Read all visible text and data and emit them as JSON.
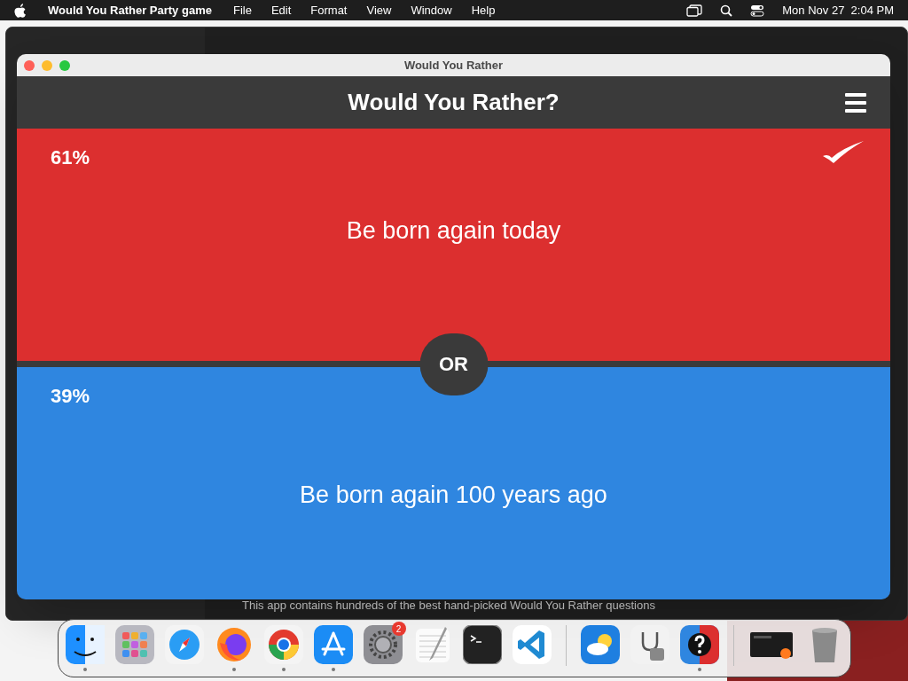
{
  "menu_bar": {
    "app_name": "Would You Rather Party game",
    "menus": [
      "File",
      "Edit",
      "Format",
      "View",
      "Window",
      "Help"
    ],
    "clock": "Mon Nov 27  2:04 PM"
  },
  "background_window": {
    "description": "This app contains hundreds of the best hand-picked Would You Rather questions"
  },
  "window": {
    "title": "Would You Rather",
    "header": "Would You Rather?",
    "divider_label": "OR",
    "options": [
      {
        "percent": "61%",
        "text": "Be born again today",
        "color": "#dc2f2f",
        "selected": true
      },
      {
        "percent": "39%",
        "text": "Be born again 100 years ago",
        "color": "#2f86e0",
        "selected": false
      }
    ]
  },
  "dock": [
    {
      "kind": "finder",
      "running": true
    },
    {
      "kind": "launchpad",
      "running": false
    },
    {
      "kind": "safari",
      "running": false
    },
    {
      "kind": "firefox",
      "running": true
    },
    {
      "kind": "chrome",
      "running": true
    },
    {
      "kind": "appstore",
      "running": true
    },
    {
      "kind": "settings",
      "running": false,
      "badge": "2"
    },
    {
      "kind": "textedit",
      "running": false
    },
    {
      "kind": "terminal",
      "running": false
    },
    {
      "kind": "vscode",
      "running": false
    },
    {
      "kind": "separator"
    },
    {
      "kind": "weather",
      "running": false
    },
    {
      "kind": "diskutility",
      "running": false
    },
    {
      "kind": "wouldyourather",
      "running": true
    },
    {
      "kind": "separator"
    },
    {
      "kind": "minimized",
      "running": false
    },
    {
      "kind": "trash",
      "running": false
    }
  ]
}
